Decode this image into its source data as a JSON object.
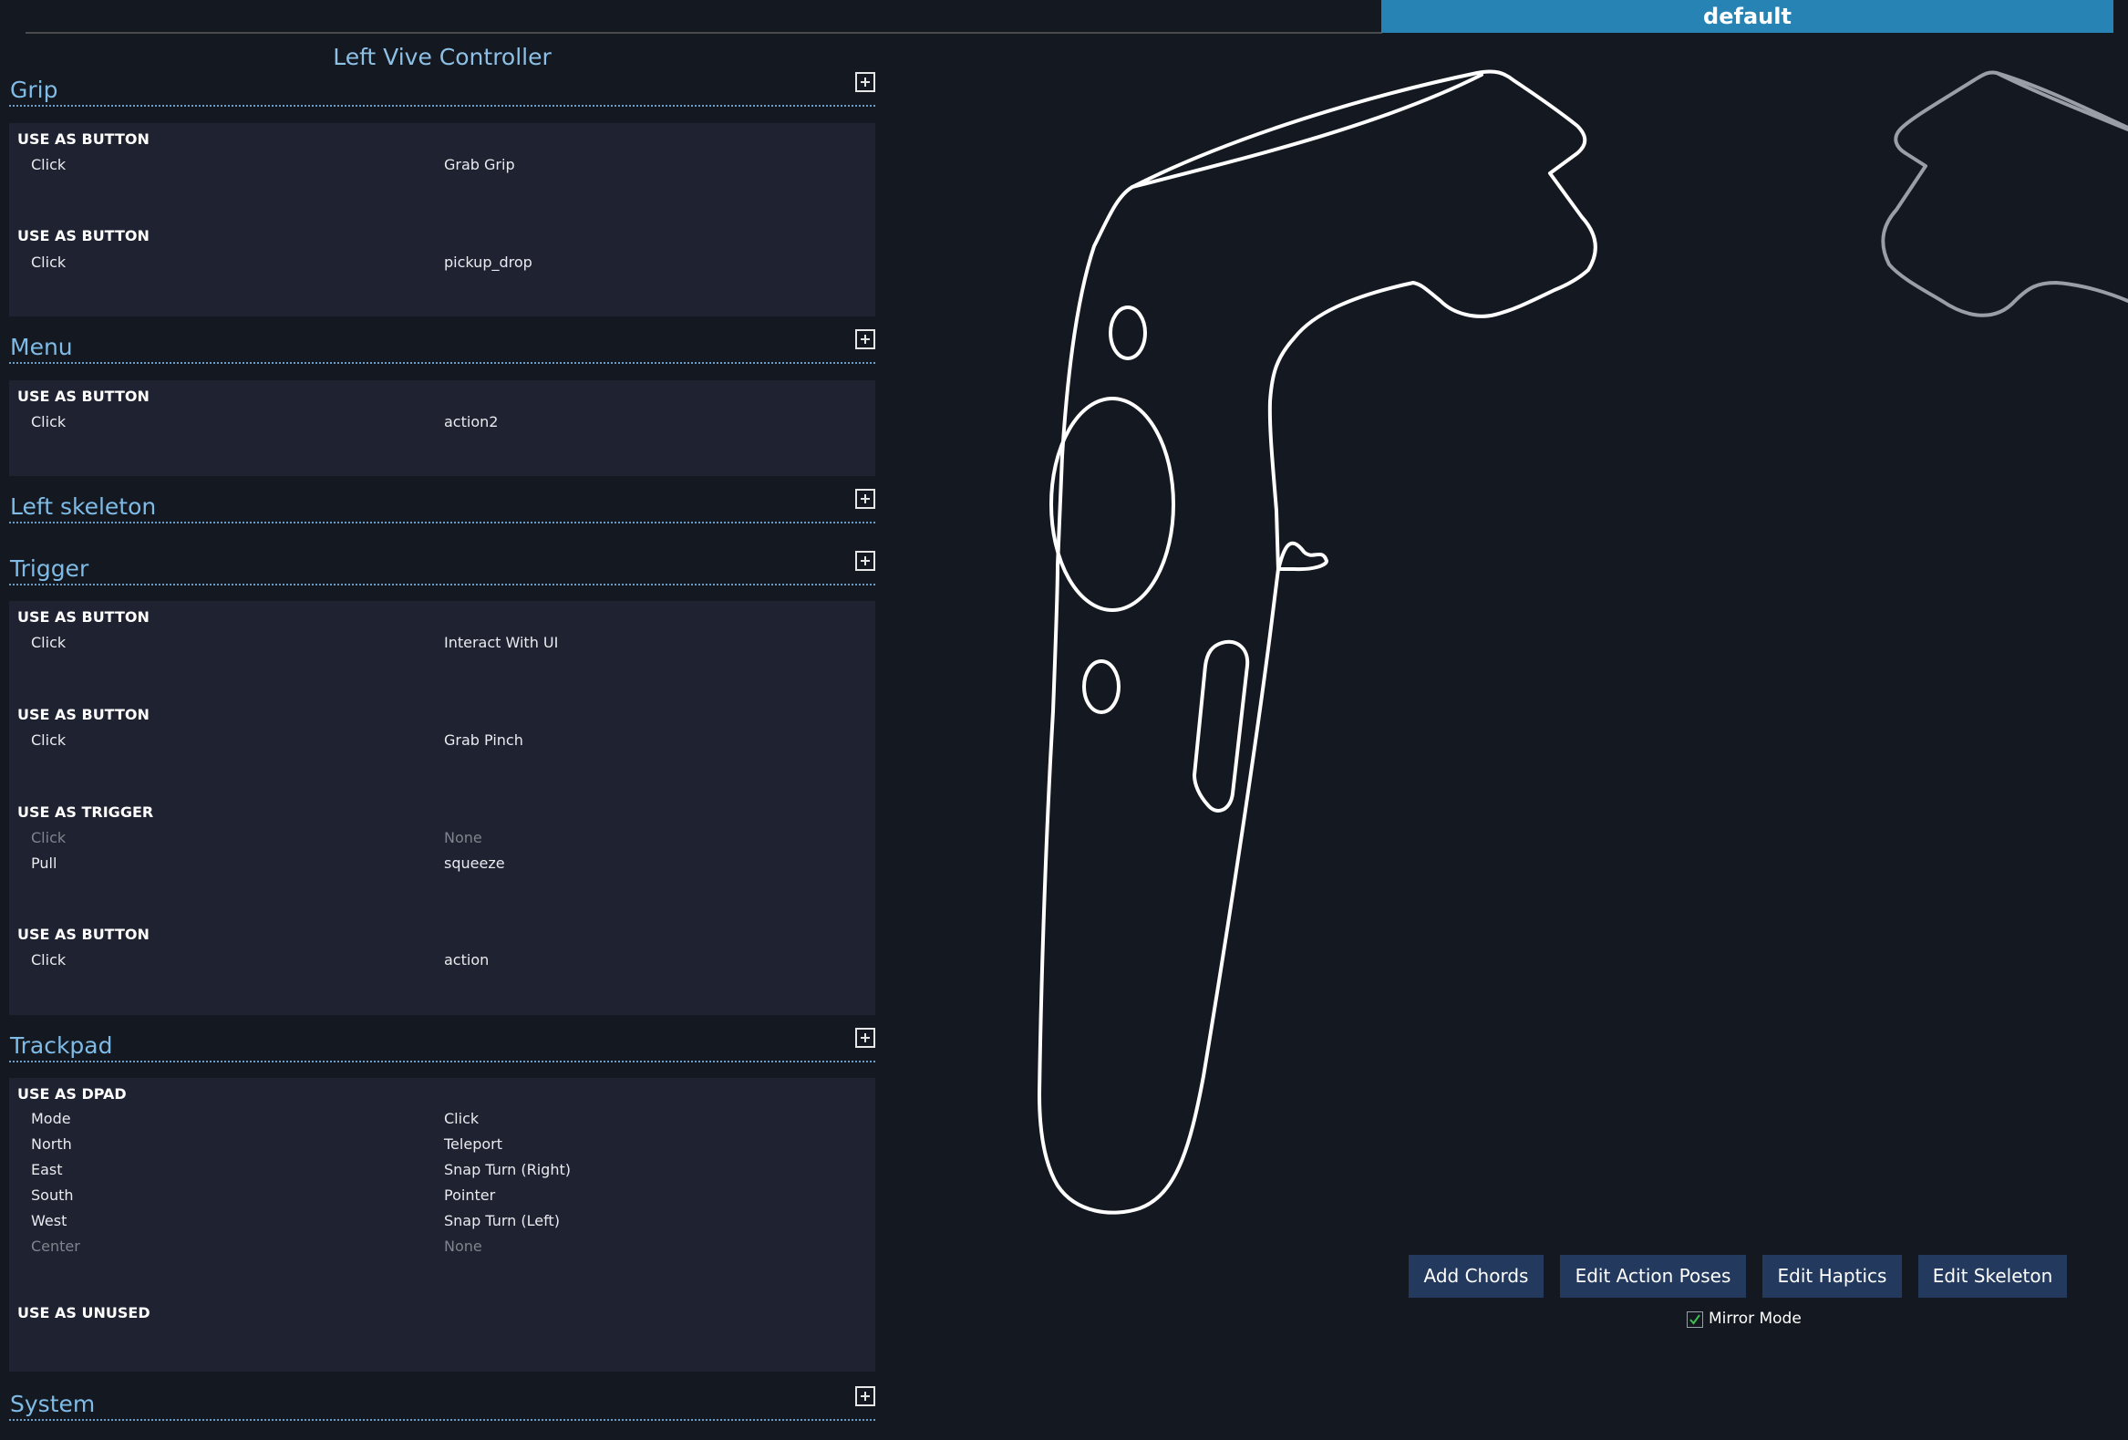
{
  "tab": {
    "label": "default"
  },
  "panel": {
    "title": "Left Vive Controller",
    "sections": {
      "grip": {
        "title": "Grip",
        "groups": [
          {
            "title": "USE AS BUTTON",
            "rows": [
              {
                "label": "Click",
                "value": "Grab Grip"
              }
            ]
          },
          {
            "title": "USE AS BUTTON",
            "rows": [
              {
                "label": "Click",
                "value": "pickup_drop"
              }
            ]
          }
        ]
      },
      "menu": {
        "title": "Menu",
        "groups": [
          {
            "title": "USE AS BUTTON",
            "rows": [
              {
                "label": "Click",
                "value": "action2"
              }
            ]
          }
        ]
      },
      "left_skeleton": {
        "title": "Left skeleton"
      },
      "trigger": {
        "title": "Trigger",
        "groups": [
          {
            "title": "USE AS BUTTON",
            "rows": [
              {
                "label": "Click",
                "value": "Interact With UI"
              }
            ]
          },
          {
            "title": "USE AS BUTTON",
            "rows": [
              {
                "label": "Click",
                "value": "Grab Pinch"
              }
            ]
          },
          {
            "title": "USE AS TRIGGER",
            "rows": [
              {
                "label": "Click",
                "value": "None"
              },
              {
                "label": "Pull",
                "value": "squeeze"
              }
            ]
          },
          {
            "title": "USE AS BUTTON",
            "rows": [
              {
                "label": "Click",
                "value": "action"
              }
            ]
          }
        ]
      },
      "trackpad": {
        "title": "Trackpad",
        "groups": [
          {
            "title": "USE AS DPAD",
            "rows": [
              {
                "label": "Mode",
                "value": "Click"
              },
              {
                "label": "North",
                "value": "Teleport"
              },
              {
                "label": "East",
                "value": "Snap Turn (Right)"
              },
              {
                "label": "South",
                "value": "Pointer"
              },
              {
                "label": "West",
                "value": "Snap Turn (Left)"
              },
              {
                "label": "Center",
                "value": "None"
              }
            ]
          },
          {
            "title": "USE AS UNUSED",
            "rows": []
          }
        ]
      },
      "system": {
        "title": "System"
      }
    }
  },
  "buttons": {
    "add_chords": "Add Chords",
    "edit_action_poses": "Edit Action Poses",
    "edit_haptics": "Edit Haptics",
    "edit_skeleton": "Edit Skeleton"
  },
  "mirror_mode": {
    "label": "Mirror Mode",
    "checked": true
  },
  "colors": {
    "background": "#141820",
    "section_body": "#1e2231",
    "accent_tab": "#2783b4",
    "section_title": "#7fbbe7",
    "button_bg": "#233a5e",
    "checkmark": "#3fbf4f"
  }
}
